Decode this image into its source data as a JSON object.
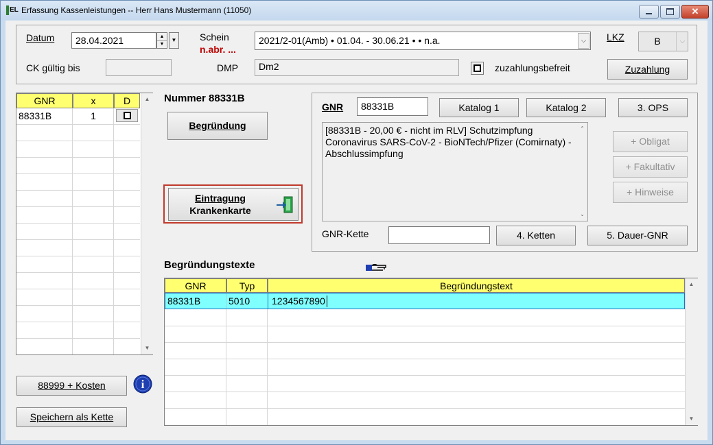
{
  "window": {
    "title": "Erfassung Kassenleistungen --  Herr Hans Mustermann (11050)",
    "icon_text": "EL",
    "close_glyph": "✕"
  },
  "header": {
    "datum_label": "Datum",
    "datum_value": "28.04.2021",
    "schein_label": "Schein",
    "schein_status": "n.abr. ...",
    "schein_value": "2021/2-01(Amb) • 01.04. - 30.06.21 •   • n.a.",
    "lkz_label": "LKZ",
    "lkz_value": "B",
    "ck_label": "CK gültig bis",
    "ck_value": "",
    "dmp_label": "DMP",
    "dmp_value": "Dm2",
    "zuzahlung_label": "zuzahlungsbefreit",
    "zuzahlung_button": "Zuzahlung"
  },
  "gnr_list": {
    "columns": [
      "GNR",
      "x",
      "D"
    ],
    "rows": [
      {
        "gnr": "88331B",
        "x": "1"
      }
    ]
  },
  "middle": {
    "nummer_title": "Nummer 88331B",
    "begruendung_button": "Begründung",
    "eintragung_line1": "Eintragung",
    "eintragung_line2": "Krankenkarte"
  },
  "right_panel": {
    "gnr_label": "GNR",
    "gnr_value": "88331B",
    "katalog1": "Katalog 1",
    "katalog2": "Katalog 2",
    "ops": "3. OPS",
    "description": "[88331B - 20,00 € - nicht im RLV]  Schutzimpfung Coronavirus SARS-CoV-2 - BioNTech/Pfizer (Comirnaty) - Abschlussimpfung",
    "obligat": "+ Obligat",
    "fakultativ": "+ Fakultativ",
    "hinweise": "+ Hinweise",
    "kette_label": "GNR-Kette",
    "kette_value": "",
    "ketten_button": "4. Ketten",
    "dauer_button": "5. Dauer-GNR"
  },
  "begruendungstexte": {
    "title": "Begründungstexte",
    "columns": [
      "GNR",
      "Typ",
      "Begründungstext"
    ],
    "rows": [
      {
        "gnr": "88331B",
        "typ": "5010",
        "text": "1234567890"
      }
    ]
  },
  "bottom_left": {
    "kosten_button": "88999 + Kosten",
    "speichern_button": "Speichern als Kette"
  },
  "colors": {
    "grid_header": "#ffff70",
    "selected_row": "#80ffff",
    "highlight_border": "#c0392b",
    "schein_status": "#c00000"
  }
}
